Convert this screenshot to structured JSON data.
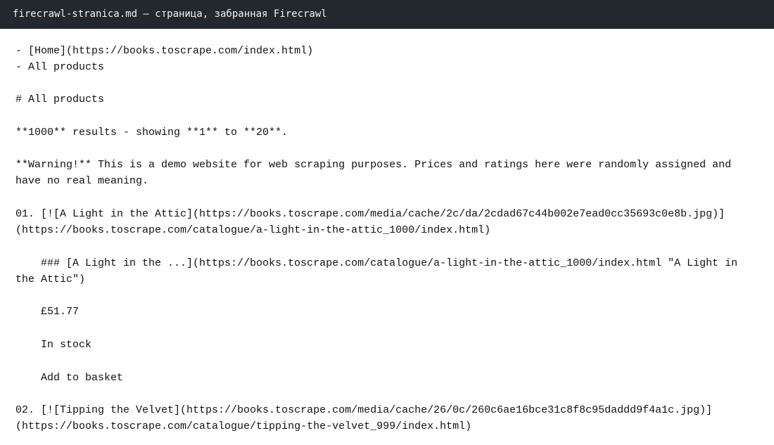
{
  "window": {
    "title": "firecrawl-stranica.md — страница, забранная Firecrawl"
  },
  "document": {
    "lines": [
      "- [Home](https://books.toscrape.com/index.html)",
      "- All products",
      "# All products",
      "**1000** results - showing **1** to **20**.",
      "**Warning!** This is a demo website for web scraping purposes. Prices and ratings here were randomly assigned and",
      "have no real meaning.",
      "01. [![A Light in the Attic](https://books.toscrape.com/media/cache/2c/da/2cdad67c44b002e7ead0cc35693c0e8b.jpg)]",
      "(https://books.toscrape.com/catalogue/a-light-in-the-attic_1000/index.html)",
      "### [A Light in the ...](https://books.toscrape.com/catalogue/a-light-in-the-attic_1000/index.html \"A Light in",
      "the Attic\")",
      "£51.77",
      "In stock",
      "Add to basket",
      "02. [![Tipping the Velvet](https://books.toscrape.com/media/cache/26/0c/260c6ae16bce31c8f8c95daddd9f4a1c.jpg)]",
      "(https://books.toscrape.com/catalogue/tipping-the-velvet_999/index.html)"
    ]
  }
}
